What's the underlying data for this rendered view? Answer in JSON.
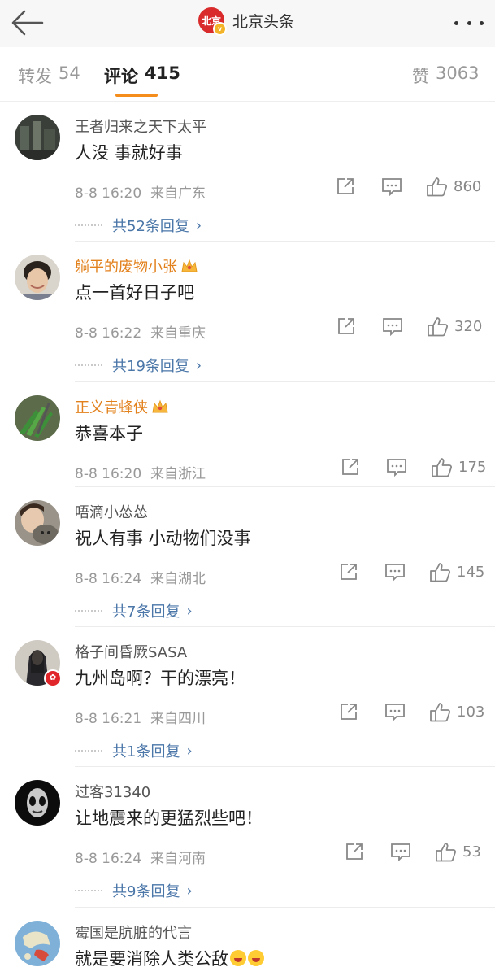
{
  "header": {
    "back_icon": "arrow-left-icon",
    "logo_text": "北京",
    "verified_badge": "v",
    "account_name": "北京头条",
    "more_icon": "more-dots-icon"
  },
  "tabs": [
    {
      "label": "转发",
      "count": "54",
      "active": false
    },
    {
      "label": "评论",
      "count": "415",
      "active": true
    },
    {
      "label": "赞",
      "count": "3063",
      "active": false
    }
  ],
  "colors": {
    "accent": "#f48d1b",
    "vip_name": "#e2801b",
    "link": "#4a76a8",
    "logo_red": "#d92b2b"
  },
  "comments": [
    {
      "name": "王者归来之天下太平",
      "vip": false,
      "text": "人没  事就好事",
      "time": "8-8 16:20",
      "location": "来自广东",
      "likes": "860",
      "replies": "共52条回复"
    },
    {
      "name": "躺平的废物小张",
      "vip": true,
      "text": "点一首好日子吧",
      "time": "8-8 16:22",
      "location": "来自重庆",
      "likes": "320",
      "replies": "共19条回复"
    },
    {
      "name": "正义青蜂侠",
      "vip": true,
      "text": "恭喜本子",
      "time": "8-8 16:20",
      "location": "来自浙江",
      "likes": "175",
      "replies": ""
    },
    {
      "name": "唔滴小怂怂",
      "vip": false,
      "text": "祝人有事  小动物们没事",
      "time": "8-8 16:24",
      "location": "来自湖北",
      "likes": "145",
      "replies": "共7条回复"
    },
    {
      "name": "格子间昏厥SASA",
      "vip": false,
      "text": "九州岛啊？干的漂亮！",
      "time": "8-8 16:21",
      "location": "来自四川",
      "likes": "103",
      "replies": "共1条回复"
    },
    {
      "name": "过客31340",
      "vip": false,
      "text": "让地震来的更猛烈些吧！",
      "time": "8-8 16:24",
      "location": "来自河南",
      "likes": "53",
      "replies": "共9条回复"
    },
    {
      "name": "霉国是肮脏的代言",
      "vip": false,
      "text": "就是要消除人类公敌",
      "time": "",
      "location": "",
      "likes": "",
      "replies": ""
    }
  ]
}
